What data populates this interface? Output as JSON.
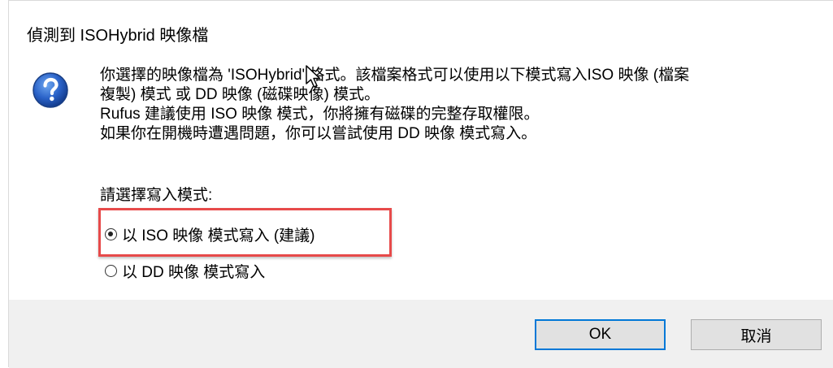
{
  "dialog": {
    "title": "偵測到 ISOHybrid 映像檔",
    "icon": "question-icon",
    "message_lines": [
      "你選擇的映像檔為 'ISOHybrid' 格式。該檔案格式可以使用以下模式寫入ISO 映像 (檔案",
      "複製) 模式 或 DD 映像 (磁碟映像) 模式。",
      "Rufus 建議使用 ISO 映像 模式，你將擁有磁碟的完整存取權限。",
      "如果你在開機時遭遇問題，你可以嘗試使用 DD 映像 模式寫入。"
    ],
    "prompt": "請選擇寫入模式:",
    "options": [
      {
        "label": "以 ISO 映像 模式寫入 (建議)",
        "selected": true
      },
      {
        "label": "以 DD 映像 模式寫入",
        "selected": false
      }
    ],
    "buttons": {
      "ok": "OK",
      "cancel": "取消"
    }
  },
  "colors": {
    "highlight_border": "#e74a4a",
    "ok_border": "#0078d7",
    "footer_bg": "#f0f0f0"
  }
}
